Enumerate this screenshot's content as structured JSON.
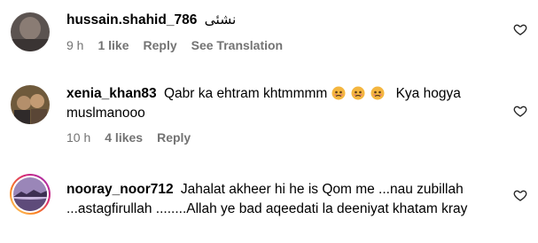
{
  "comments": [
    {
      "username": "hussain.shahid_786",
      "text": "نشئی",
      "time": "9 h",
      "likes": "1 like",
      "reply": "Reply",
      "translate": "See Translation"
    },
    {
      "username": "xenia_khan83",
      "text_before": "Qabr ka ehtram khtmmmm",
      "emoji": "sad-face-emoji",
      "text_after": "Kya hogya muslmanooo",
      "time": "10 h",
      "likes": "4 likes",
      "reply": "Reply"
    },
    {
      "username": "nooray_noor712",
      "text": "Jahalat akheer hi he is Qom me ...nau zubillah ...astagfirullah ........Allah ye bad aqeedati la deeniyat khatam kray"
    }
  ],
  "colors": {
    "meta_gray": "#737373",
    "story_ring": [
      "#feda75",
      "#fa7e1e",
      "#d62976",
      "#962fbf"
    ]
  }
}
